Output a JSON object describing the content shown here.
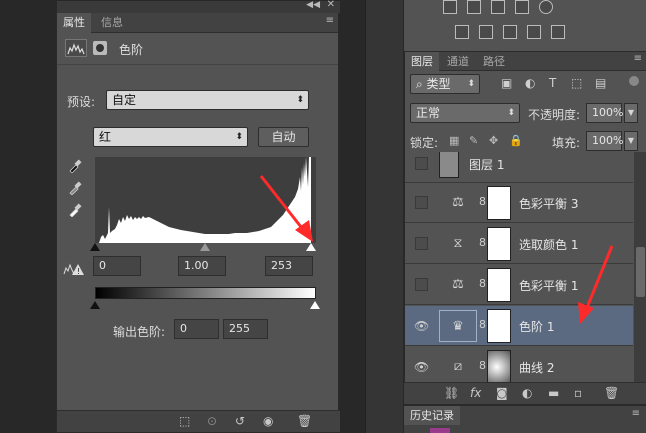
{
  "properties_panel": {
    "tabs": [
      "属性",
      "信息"
    ],
    "title": "色阶",
    "preset_label": "预设:",
    "preset_value": "自定",
    "channel_value": "红",
    "auto_button": "自动",
    "input_levels": {
      "black": "0",
      "gamma": "1.00",
      "white": "253"
    },
    "output_label": "输出色阶:",
    "output_levels": {
      "black": "0",
      "white": "255"
    }
  },
  "layers_panel": {
    "tabs": [
      "图层",
      "通道",
      "路径"
    ],
    "filter_kind": "类型",
    "blend_mode": "正常",
    "opacity_label": "不透明度:",
    "opacity_value": "100%",
    "lock_label": "锁定:",
    "fill_label": "填充:",
    "fill_value": "100%",
    "layers": [
      {
        "name": "图层 1",
        "type": "pixel",
        "visible": false,
        "selected": false,
        "icon": "layer-thumb"
      },
      {
        "name": "色彩平衡 3",
        "type": "adjustment",
        "visible": false,
        "selected": false,
        "icon": "balance-icon"
      },
      {
        "name": "选取颜色 1",
        "type": "adjustment",
        "visible": false,
        "selected": false,
        "icon": "selective-color-icon"
      },
      {
        "name": "色彩平衡 1",
        "type": "adjustment",
        "visible": false,
        "selected": false,
        "icon": "balance-icon"
      },
      {
        "name": "色阶 1",
        "type": "adjustment",
        "visible": true,
        "selected": true,
        "icon": "levels-icon"
      },
      {
        "name": "曲线 2",
        "type": "adjustment",
        "visible": true,
        "selected": false,
        "icon": "curves-icon"
      }
    ]
  },
  "history_panel": {
    "tab": "历史记录"
  },
  "colors": {
    "panel": "#535353",
    "selected_row": "#5b6a80",
    "annotation_arrow": "#ff2a2a"
  }
}
